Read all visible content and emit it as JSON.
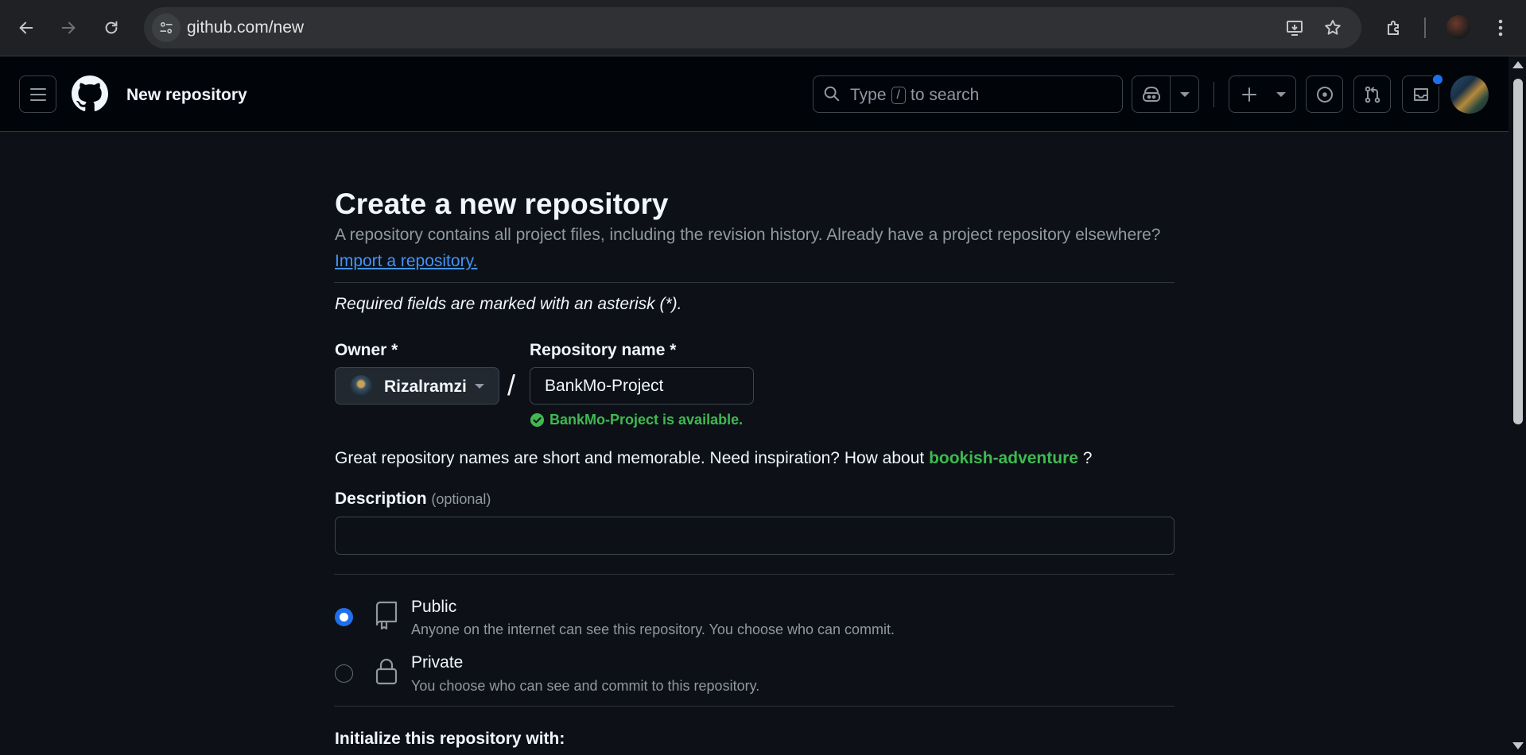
{
  "browser": {
    "url": "github.com/new",
    "icons": [
      "back-arrow-icon",
      "forward-arrow-icon",
      "reload-icon",
      "site-info-icon",
      "install-app-icon",
      "bookmark-star-icon",
      "extensions-puzzle-icon",
      "profile-avatar",
      "kebab-menu-icon"
    ]
  },
  "header": {
    "page_title": "New repository",
    "search": {
      "prefix": "Type",
      "key": "/",
      "suffix": "to search"
    },
    "icons": [
      "hamburger-icon",
      "github-logo-icon",
      "copilot-icon",
      "chevron-down-icon",
      "plus-icon",
      "issues-icon",
      "pull-requests-icon",
      "inbox-icon"
    ],
    "accent_color": "#1f6feb"
  },
  "main": {
    "title": "Create a new repository",
    "intro": "A repository contains all project files, including the revision history. Already have a project repository elsewhere?",
    "import_link": "Import a repository.",
    "required_note": "Required fields are marked with an asterisk (*).",
    "owner_label": "Owner *",
    "owner_value": "Rizalramzi",
    "slash": "/",
    "repo_label": "Repository name *",
    "repo_value": "BankMo-Project",
    "availability": "BankMo-Project is available.",
    "availability_color": "#3fb950",
    "inspiration_prefix": "Great repository names are short and memorable. Need inspiration? How about",
    "inspiration_suggestion": "bookish-adventure",
    "inspiration_suffix": "?",
    "description_label": "Description",
    "description_optional": "(optional)",
    "description_value": "",
    "visibility": [
      {
        "title": "Public",
        "desc": "Anyone on the internet can see this repository. You choose who can commit.",
        "icon": "repo-icon",
        "checked": true
      },
      {
        "title": "Private",
        "desc": "You choose who can see and commit to this repository.",
        "icon": "lock-icon",
        "checked": false
      }
    ],
    "init_title": "Initialize this repository with:"
  }
}
